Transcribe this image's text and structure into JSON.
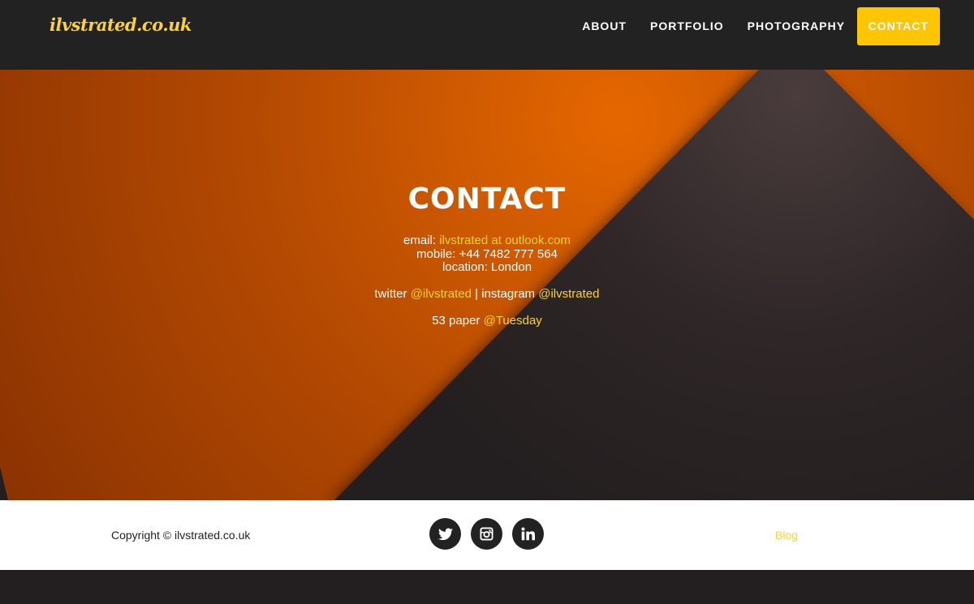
{
  "nav": {
    "brand": "ilvstrated.co.uk",
    "items": [
      {
        "label": "ABOUT"
      },
      {
        "label": "PORTFOLIO"
      },
      {
        "label": "PHOTOGRAPHY"
      },
      {
        "label": "CONTACT"
      }
    ],
    "active_color": "#fec503"
  },
  "hero": {
    "title": "CONTACT",
    "email_label": "email:",
    "email_value": "ilvstrated at outlook.com",
    "mobile": "mobile: +44 7482 777 564",
    "location": "location: London",
    "twitter_label": "twitter",
    "twitter_handle": "@ilvstrated",
    "separator": "| instagram",
    "instagram_handle": "@ilvstrated",
    "paper_label": "53 paper",
    "paper_handle": "@Tuesday",
    "colors": {
      "orange": "#d96000",
      "dark": "#231e1f",
      "accent": "#fed136"
    }
  },
  "footer": {
    "copyright": "Copyright © ilvstrated.co.uk",
    "social_icons": [
      "twitter-icon",
      "instagram-icon",
      "linkedin-icon"
    ],
    "blog_link": "Blog"
  }
}
